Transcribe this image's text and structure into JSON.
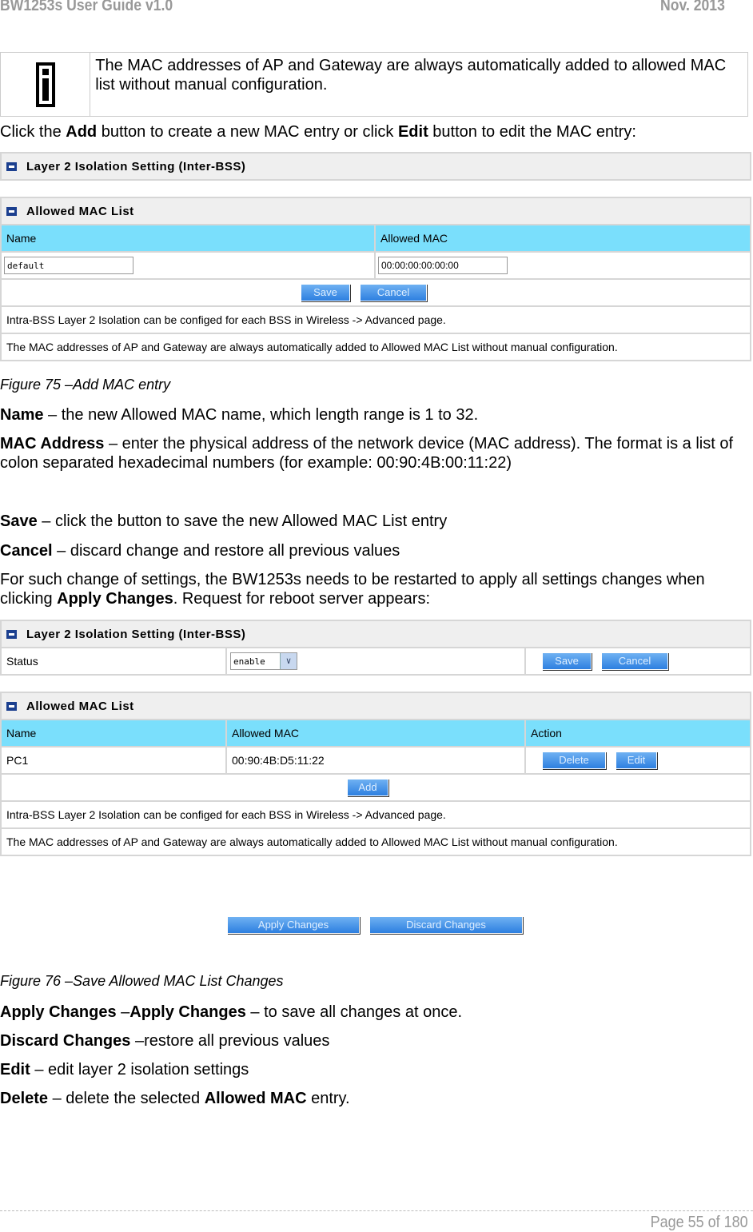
{
  "header": {
    "title": "BW1253s User Guide v1.0",
    "date": "Nov.  2013"
  },
  "info_note": {
    "icon": "info-icon",
    "text": "The MAC addresses of AP and Gateway are always automatically added to allowed MAC list without manual configuration."
  },
  "intro": {
    "a": "Click the ",
    "b": "Add",
    "c": " button to create a new MAC entry or click ",
    "d": "Edit",
    "e": " button to edit the MAC entry:"
  },
  "fig75": {
    "panel1_title": "Layer 2 Isolation Setting (Inter-BSS)",
    "panel2_title": "Allowed MAC List",
    "col_name": "Name",
    "col_mac": "Allowed MAC",
    "name_value": "default",
    "mac_value": "00:00:00:00:00:00",
    "save": "Save",
    "cancel": "Cancel",
    "note1": "Intra-BSS Layer 2 Isolation can be configed for each BSS in Wireless -> Advanced page.",
    "note2": "The MAC addresses of AP and Gateway are always automatically added to Allowed MAC List without manual configuration.",
    "caption": "Figure 75 –Add MAC entry"
  },
  "desc1": [
    {
      "b": "Name",
      "t": " – the new Allowed MAC name, which length range is 1 to 32."
    },
    {
      "b": "MAC Address",
      "t": " – enter the physical address of the network device (MAC address). The format is a list of colon separated hexadecimal numbers (for example: 00:90:4B:00:11:22)"
    },
    {
      "b": "Save",
      "t": " – click the button to save the new Allowed MAC List entry"
    },
    {
      "b": "Cancel",
      "t": " – discard change and restore all previous values"
    }
  ],
  "restart": {
    "a": "For such change of settings, the BW1253s needs to be restarted to apply all settings changes when clicking ",
    "b": "Apply Changes",
    "c": ". Request for reboot server appears:"
  },
  "fig76": {
    "panel1_title": "Layer 2 Isolation Setting (Inter-BSS)",
    "status_label": "Status",
    "status_value": "enable",
    "save": "Save",
    "cancel": "Cancel",
    "panel2_title": "Allowed MAC List",
    "col_name": "Name",
    "col_mac": "Allowed MAC",
    "col_action": "Action",
    "row": {
      "name": "PC1",
      "mac": "00:90:4B:D5:11:22"
    },
    "delete": "Delete",
    "edit": "Edit",
    "add": "Add",
    "note1": "Intra-BSS Layer 2 Isolation can be configed for each BSS in Wireless -> Advanced page.",
    "note2": "The MAC addresses of AP and Gateway are always automatically added to Allowed MAC List without manual configuration.",
    "apply": "Apply Changes",
    "discard": "Discard Changes",
    "caption": "Figure 76 –Save Allowed MAC List Changes"
  },
  "desc2": [
    {
      "b": "Apply Changes",
      "t": " –",
      "b2": "Apply Changes",
      "t2": " – to save all changes at once."
    },
    {
      "b": "Discard Changes",
      "t": " –restore all previous values"
    },
    {
      "b": "Edit",
      "t": " – edit layer 2 isolation settings"
    },
    {
      "b": "Delete",
      "t": " – delete the selected ",
      "b2": "Allowed MAC",
      "t2": " entry."
    }
  ],
  "footer": {
    "page": "Page 55 of 180"
  }
}
